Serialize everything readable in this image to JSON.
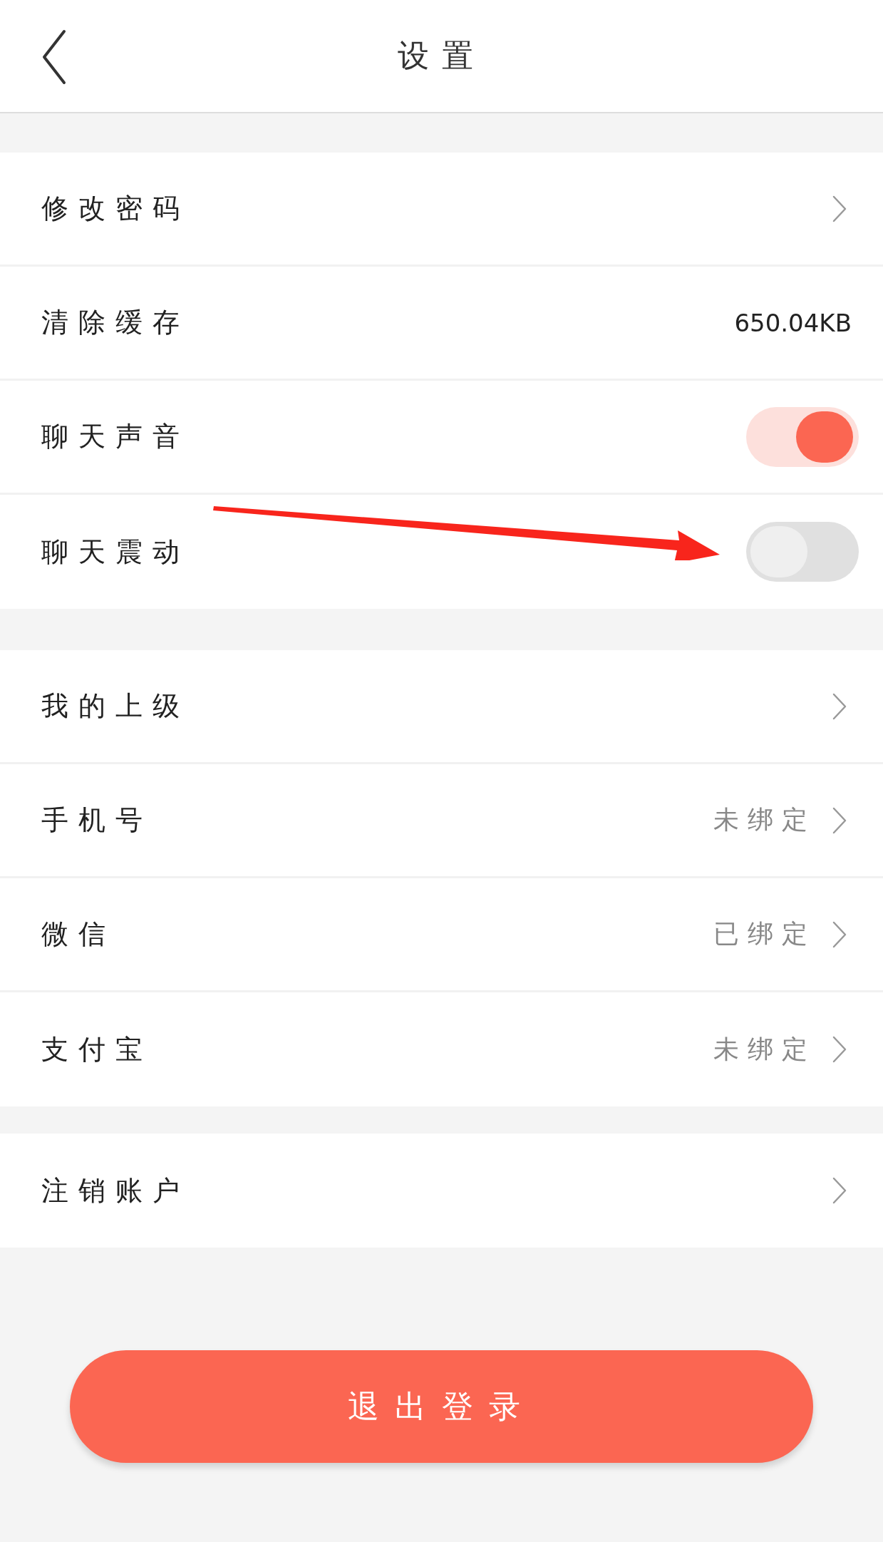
{
  "header": {
    "title": "设置"
  },
  "sections": [
    {
      "rows": [
        {
          "kind": "link",
          "label": "修改密码"
        },
        {
          "kind": "value",
          "label": "清除缓存",
          "value": "650.04KB"
        },
        {
          "kind": "toggle",
          "label": "聊天声音",
          "on": true
        },
        {
          "kind": "toggle",
          "label": "聊天震动",
          "on": false
        }
      ]
    },
    {
      "rows": [
        {
          "kind": "link",
          "label": "我的上级"
        },
        {
          "kind": "link",
          "label": "手机号",
          "value": "未绑定"
        },
        {
          "kind": "link",
          "label": "微信",
          "value": "已绑定"
        },
        {
          "kind": "link",
          "label": "支付宝",
          "value": "未绑定"
        }
      ]
    },
    {
      "rows": [
        {
          "kind": "link",
          "label": "注销账户"
        }
      ]
    }
  ],
  "logout_button": "退出登录"
}
